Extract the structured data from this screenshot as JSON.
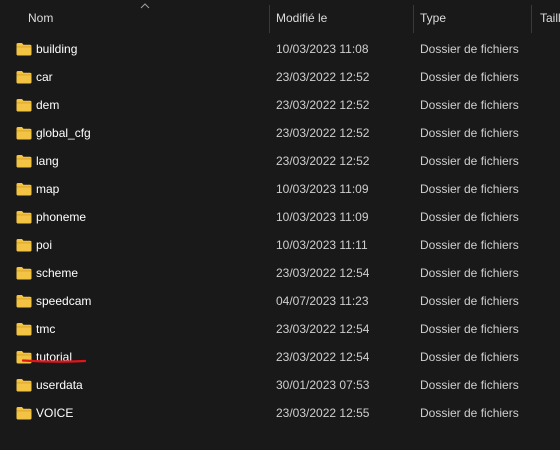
{
  "columns": {
    "name": "Nom",
    "modified": "Modifié le",
    "type": "Type",
    "size": "Taille"
  },
  "files": [
    {
      "name": "building",
      "modified": "10/03/2023 11:08",
      "type": "Dossier de fichiers"
    },
    {
      "name": "car",
      "modified": "23/03/2022 12:52",
      "type": "Dossier de fichiers"
    },
    {
      "name": "dem",
      "modified": "23/03/2022 12:52",
      "type": "Dossier de fichiers"
    },
    {
      "name": "global_cfg",
      "modified": "23/03/2022 12:52",
      "type": "Dossier de fichiers"
    },
    {
      "name": "lang",
      "modified": "23/03/2022 12:52",
      "type": "Dossier de fichiers"
    },
    {
      "name": "map",
      "modified": "10/03/2023 11:09",
      "type": "Dossier de fichiers"
    },
    {
      "name": "phoneme",
      "modified": "10/03/2023 11:09",
      "type": "Dossier de fichiers"
    },
    {
      "name": "poi",
      "modified": "10/03/2023 11:11",
      "type": "Dossier de fichiers"
    },
    {
      "name": "scheme",
      "modified": "23/03/2022 12:54",
      "type": "Dossier de fichiers"
    },
    {
      "name": "speedcam",
      "modified": "04/07/2023 11:23",
      "type": "Dossier de fichiers"
    },
    {
      "name": "tmc",
      "modified": "23/03/2022 12:54",
      "type": "Dossier de fichiers"
    },
    {
      "name": "tutorial",
      "modified": "23/03/2022 12:54",
      "type": "Dossier de fichiers"
    },
    {
      "name": "userdata",
      "modified": "30/01/2023 07:53",
      "type": "Dossier de fichiers"
    },
    {
      "name": "VOICE",
      "modified": "23/03/2022 12:55",
      "type": "Dossier de fichiers"
    }
  ],
  "icons": {
    "folder": "folder-icon",
    "sort": "sort-ascending-icon"
  },
  "colors": {
    "background": "#191919",
    "folder": "#f3c443",
    "annotation": "#e0141b"
  }
}
